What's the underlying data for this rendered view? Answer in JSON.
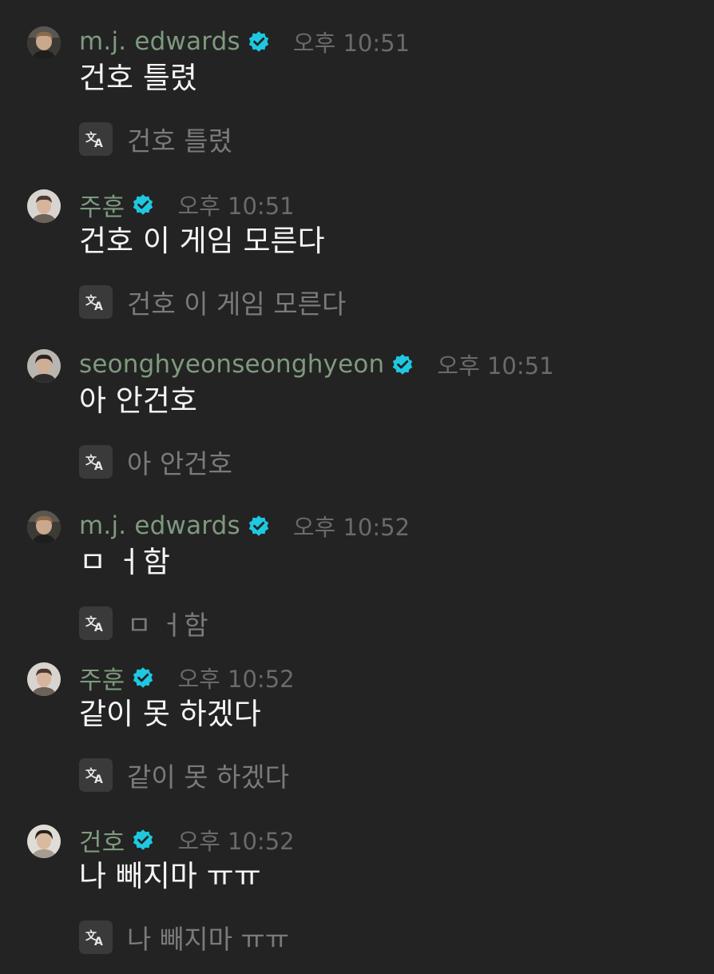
{
  "colors": {
    "background": "#232323",
    "username": "#7e9a7e",
    "timestamp": "#6a6a6a",
    "message_text": "#f5f5f5",
    "translated_text": "#7a7a7a",
    "verified_badge": "#1ec8e0",
    "translate_button_bg": "#3a3a3a"
  },
  "messages": [
    {
      "username": "m.j. edwards",
      "verified": true,
      "timestamp": "오후 10:51",
      "text": "건호 틀렸",
      "translation": "건호 틀렸",
      "avatar_icon": "avatar-photo"
    },
    {
      "username": "주훈",
      "verified": true,
      "timestamp": "오후 10:51",
      "text": "건호 이 게임 모른다",
      "translation": "건호 이 게임 모른다",
      "avatar_icon": "avatar-photo"
    },
    {
      "username": "seonghyeonseonghyeon",
      "verified": true,
      "timestamp": "오후 10:51",
      "text": "아 안건호",
      "translation": "아 안건호",
      "avatar_icon": "avatar-photo"
    },
    {
      "username": "m.j. edwards",
      "verified": true,
      "timestamp": "오후 10:52",
      "text": "ㅁ ㅓ함",
      "translation": "ㅁ ㅓ함",
      "avatar_icon": "avatar-photo"
    },
    {
      "username": "주훈",
      "verified": true,
      "timestamp": "오후 10:52",
      "text": "같이 못 하겠다",
      "translation": "같이 못 하겠다",
      "avatar_icon": "avatar-photo"
    },
    {
      "username": "건호",
      "verified": true,
      "timestamp": "오후 10:52",
      "text": "나 빼지마 ㅠㅠ",
      "translation": "나 빼지마 ㅠㅠ",
      "avatar_icon": "avatar-photo"
    }
  ]
}
